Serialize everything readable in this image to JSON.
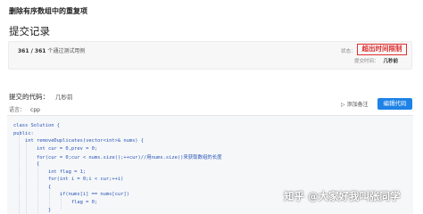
{
  "problem_title": "删除有序数组中的重复项",
  "section_title": "提交记录",
  "result": {
    "passed": "361 / 361",
    "passed_suffix": "个通过测试用例",
    "status_label": "状态：",
    "status_value": "超出时间限制",
    "submit_time_label": "提交时间：",
    "submit_time_value": "几秒前"
  },
  "code_section": {
    "title": "提交的代码：",
    "time": "几秒前",
    "language_label": "语言：",
    "language_value": "cpp",
    "add_note_label": "添加备注",
    "edit_button_label": "编辑代码"
  },
  "code_lines": [
    "class Solution {",
    "public:",
    "    int removeDuplicates(vector<int>& nums) {",
    "        int cur = 0,prev = 0;",
    "        for(cur = 0;cur < nums.size();++cur)//用nums.size()来获取数组的长度",
    "        {",
    "            int flag = 1;",
    "            for(int i = 0;i < cur;++i)",
    "            {",
    "                if(nums[i] == nums[cur])",
    "                    flag = 0;",
    "            }"
  ],
  "watermark": "知乎 @大家好我叫张同学"
}
